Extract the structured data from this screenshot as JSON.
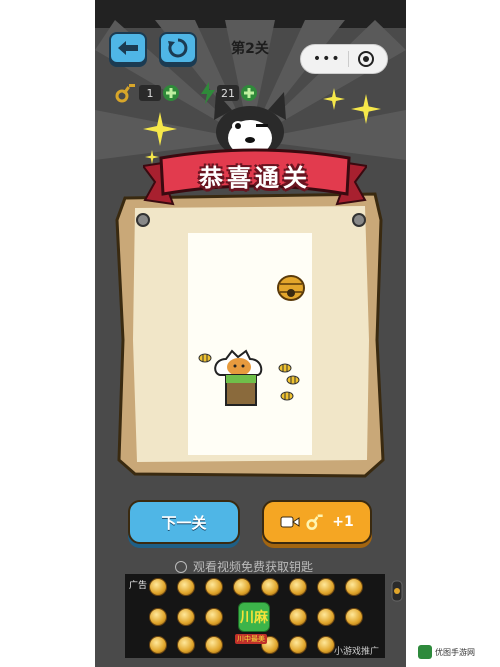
{
  "header": {
    "level_title": "第2关",
    "back_icon": "back-arrow-icon",
    "restart_icon": "restart-icon",
    "menu_icon": "more-dots-icon",
    "close_icon": "target-close-icon"
  },
  "stats": {
    "keys": "1",
    "energy": "21"
  },
  "result": {
    "banner": "恭喜通关"
  },
  "actions": {
    "next_label": "下一关",
    "bonus_label": "+1",
    "watch_label": "观看视频免费获取钥匙"
  },
  "ad": {
    "label": "广告",
    "logo_text": "川麻",
    "logo_sub": "川中最美",
    "footer": "小游戏推广"
  },
  "watermark": {
    "text": "优图手游网"
  },
  "colors": {
    "phone_bg": "#4a4a4a",
    "ribbon": "#e23b4e",
    "blue_button": "#4fb6e6",
    "orange_button": "#f5a623",
    "parchment": "#f1e6c8"
  }
}
